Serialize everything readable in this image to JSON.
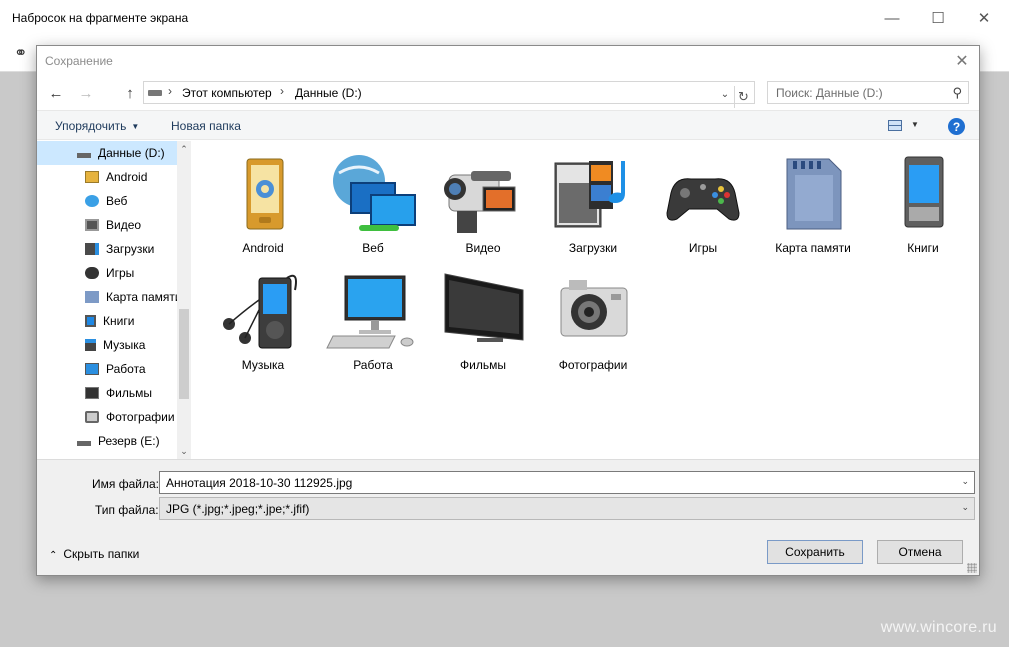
{
  "app": {
    "title": "Набросок на фрагменте экрана",
    "watermark": "www.wincore.ru"
  },
  "dialog": {
    "title": "Сохранение",
    "address": {
      "crumbs": [
        "Этот компьютер",
        "Данные (D:)"
      ]
    },
    "search": {
      "placeholder": "Поиск: Данные (D:)"
    },
    "commands": {
      "organize": "Упорядочить",
      "new_folder": "Новая папка"
    },
    "nav_items": [
      {
        "label": "Данные (D:)",
        "icon": "drive-icon",
        "selected": true
      },
      {
        "label": "Android",
        "icon": "android-folder-icon"
      },
      {
        "label": "Веб",
        "icon": "web-folder-icon"
      },
      {
        "label": "Видео",
        "icon": "video-folder-icon"
      },
      {
        "label": "Загрузки",
        "icon": "downloads-folder-icon"
      },
      {
        "label": "Игры",
        "icon": "games-folder-icon"
      },
      {
        "label": "Карта памяти",
        "icon": "memory-card-icon"
      },
      {
        "label": "Книги",
        "icon": "books-folder-icon"
      },
      {
        "label": "Музыка",
        "icon": "music-folder-icon"
      },
      {
        "label": "Работа",
        "icon": "work-folder-icon"
      },
      {
        "label": "Фильмы",
        "icon": "movies-folder-icon"
      },
      {
        "label": "Фотографии",
        "icon": "photos-folder-icon"
      },
      {
        "label": "Резерв (E:)",
        "icon": "drive-icon"
      }
    ],
    "folders": [
      {
        "label": "Android",
        "icon": "android-phone-icon"
      },
      {
        "label": "Веб",
        "icon": "globe-monitors-icon"
      },
      {
        "label": "Видео",
        "icon": "camcorder-icon"
      },
      {
        "label": "Загрузки",
        "icon": "media-player-icon"
      },
      {
        "label": "Игры",
        "icon": "gamepad-icon"
      },
      {
        "label": "Карта памяти",
        "icon": "sd-card-icon"
      },
      {
        "label": "Книги",
        "icon": "ebook-reader-icon"
      },
      {
        "label": "Музыка",
        "icon": "mp3-player-icon"
      },
      {
        "label": "Работа",
        "icon": "desktop-computer-icon"
      },
      {
        "label": "Фильмы",
        "icon": "tv-monitor-icon"
      },
      {
        "label": "Фотографии",
        "icon": "photo-camera-icon"
      }
    ],
    "filename_label": "Имя файла:",
    "filename_value": "Аннотация 2018-10-30 112925.jpg",
    "filetype_label": "Тип файла:",
    "filetype_value": "JPG (*.jpg;*.jpeg;*.jpe;*.jfif)",
    "hide_folders": "Скрыть папки",
    "save_label": "Сохранить",
    "cancel_label": "Отмена"
  }
}
